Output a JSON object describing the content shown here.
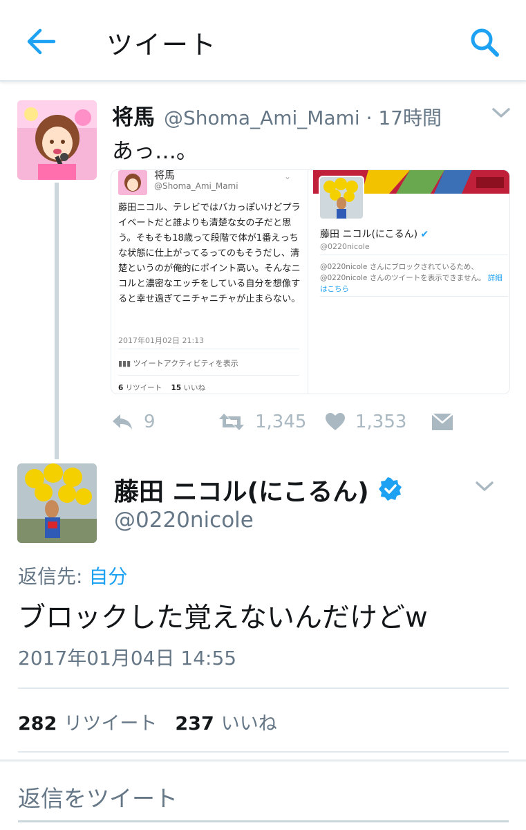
{
  "header": {
    "title": "ツイート"
  },
  "tweet1": {
    "name": "将馬",
    "handle_time": "@Shoma_Ami_Mami · 17時間",
    "text": "あっ…。",
    "screenshot_left": {
      "name": "将馬",
      "handle": "@Shoma_Ami_Mami",
      "body": "藤田ニコル、テレビではバカっぽいけどプライベートだと誰よりも清楚な女の子だと思う。そもそも18歳って段階で体が1番えっちな状態に仕上がってるってのもそうだし、清楚というのが俺的にポイント高い。そんなニコルと濃密なエッチをしている自分を想像すると幸せ過ぎてニチャニチャが止まらない。",
      "date": "2017年01月02日 21:13",
      "activity": "ツイートアクティビティを表示",
      "retweets_num": "6",
      "retweets_label": "リツイート",
      "likes_num": "15",
      "likes_label": "いいね"
    },
    "screenshot_right": {
      "name": "藤田 ニコル(にこるん)",
      "handle": "@0220nicole",
      "blocked_text": "@0220nicole さんにブロックされているため、@0220nicole さんのツイートを表示できません。",
      "blocked_link": "詳細はこちら"
    },
    "replies": "9",
    "retweets": "1,345",
    "likes": "1,353"
  },
  "tweet2": {
    "name": "藤田 ニコル(にこるん)",
    "handle": "@0220nicole",
    "reply_to_label": "返信先:",
    "reply_to_link": "自分",
    "text": "ブロックした覚えないんだけどw",
    "timestamp": "2017年01月04日 14:55",
    "retweets_num": "282",
    "retweets_label": "リツイート",
    "likes_num": "237",
    "likes_label": "いいね"
  },
  "reply_box": {
    "placeholder": "返信をツイート"
  },
  "colors": {
    "accent": "#1da1f2",
    "muted": "#657786",
    "icon_gray": "#aab8c2"
  }
}
